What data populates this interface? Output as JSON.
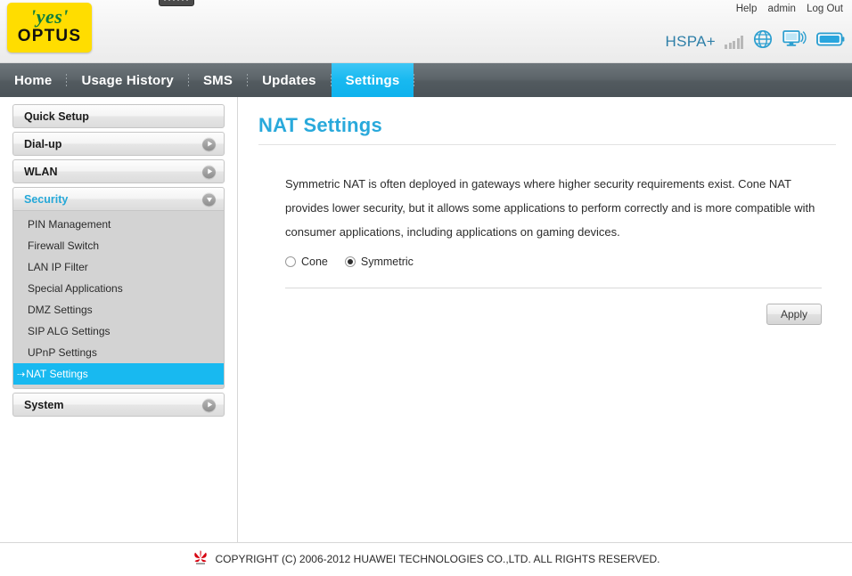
{
  "brand": {
    "logo_yes": "'yes'",
    "logo_name": "OPTUS",
    "logo_bg": "#ffdd00",
    "logo_yes_color": "#0b7d3e"
  },
  "header": {
    "account_links": [
      {
        "label": "Help",
        "name": "help-link"
      },
      {
        "label": "admin",
        "name": "admin-link"
      },
      {
        "label": "Log Out",
        "name": "log-out-link"
      }
    ],
    "status": {
      "network_label": "HSPA+",
      "network_label_color": "#2e7fa8",
      "signal_bars": 5,
      "signal_bars_active": 0,
      "signal_color": "#b8b8b8",
      "icons": [
        {
          "name": "globe-icon",
          "title": "Internet connected"
        },
        {
          "name": "monitor-broadcast-icon",
          "title": "WLAN active"
        },
        {
          "name": "battery-icon",
          "title": "Battery full"
        }
      ],
      "icon_color": "#2d9fd0"
    }
  },
  "nav": {
    "items": [
      {
        "label": "Home",
        "name": "nav-home",
        "active": false
      },
      {
        "label": "Usage History",
        "name": "nav-usage-history",
        "active": false
      },
      {
        "label": "SMS",
        "name": "nav-sms",
        "active": false
      },
      {
        "label": "Updates",
        "name": "nav-updates",
        "active": false
      },
      {
        "label": "Settings",
        "name": "nav-settings",
        "active": true
      }
    ],
    "active_bg": "#18b9f0",
    "bar_bg": "#5d656a"
  },
  "sidebar": {
    "groups": [
      {
        "label": "Quick Setup",
        "name": "sidebar-quick-setup",
        "arrow": "none",
        "expanded": false
      },
      {
        "label": "Dial-up",
        "name": "sidebar-dial-up",
        "arrow": "right",
        "expanded": false
      },
      {
        "label": "WLAN",
        "name": "sidebar-wlan",
        "arrow": "right",
        "expanded": false
      },
      {
        "label": "Security",
        "name": "sidebar-security",
        "arrow": "down",
        "expanded": true
      },
      {
        "label": "System",
        "name": "sidebar-system",
        "arrow": "right",
        "expanded": false
      }
    ],
    "security_items": [
      {
        "label": "PIN Management",
        "name": "sidebar-item-pin-management",
        "selected": false
      },
      {
        "label": "Firewall Switch",
        "name": "sidebar-item-firewall-switch",
        "selected": false
      },
      {
        "label": "LAN IP Filter",
        "name": "sidebar-item-lan-ip-filter",
        "selected": false
      },
      {
        "label": "Special Applications",
        "name": "sidebar-item-special-applications",
        "selected": false
      },
      {
        "label": "DMZ Settings",
        "name": "sidebar-item-dmz-settings",
        "selected": false
      },
      {
        "label": "SIP ALG Settings",
        "name": "sidebar-item-sip-alg-settings",
        "selected": false
      },
      {
        "label": "UPnP Settings",
        "name": "sidebar-item-upnp-settings",
        "selected": false
      },
      {
        "label": "NAT Settings",
        "name": "sidebar-item-nat-settings",
        "selected": true,
        "prefix": "⇢"
      }
    ],
    "selected_color": "#18b9f0",
    "group_active_color": "#25a8d8"
  },
  "main": {
    "title": "NAT Settings",
    "title_color": "#29a9db",
    "description": "Symmetric NAT is often deployed in gateways where higher security requirements exist. Cone NAT provides lower security, but it allows some applications to perform correctly and is more compatible with consumer applications, including applications on gaming devices.",
    "radio_group": {
      "name": "nat-type",
      "options": [
        {
          "label": "Cone",
          "name": "radio-cone",
          "selected": false
        },
        {
          "label": "Symmetric",
          "name": "radio-symmetric",
          "selected": true
        }
      ],
      "selected_value": "Symmetric"
    },
    "apply_label": "Apply"
  },
  "footer": {
    "copyright": "COPYRIGHT (C) 2006-2012 HUAWEI TECHNOLOGIES CO.,LTD. ALL RIGHTS RESERVED.",
    "logo_name": "huawei-logo",
    "logo_color": "#d6000f"
  }
}
